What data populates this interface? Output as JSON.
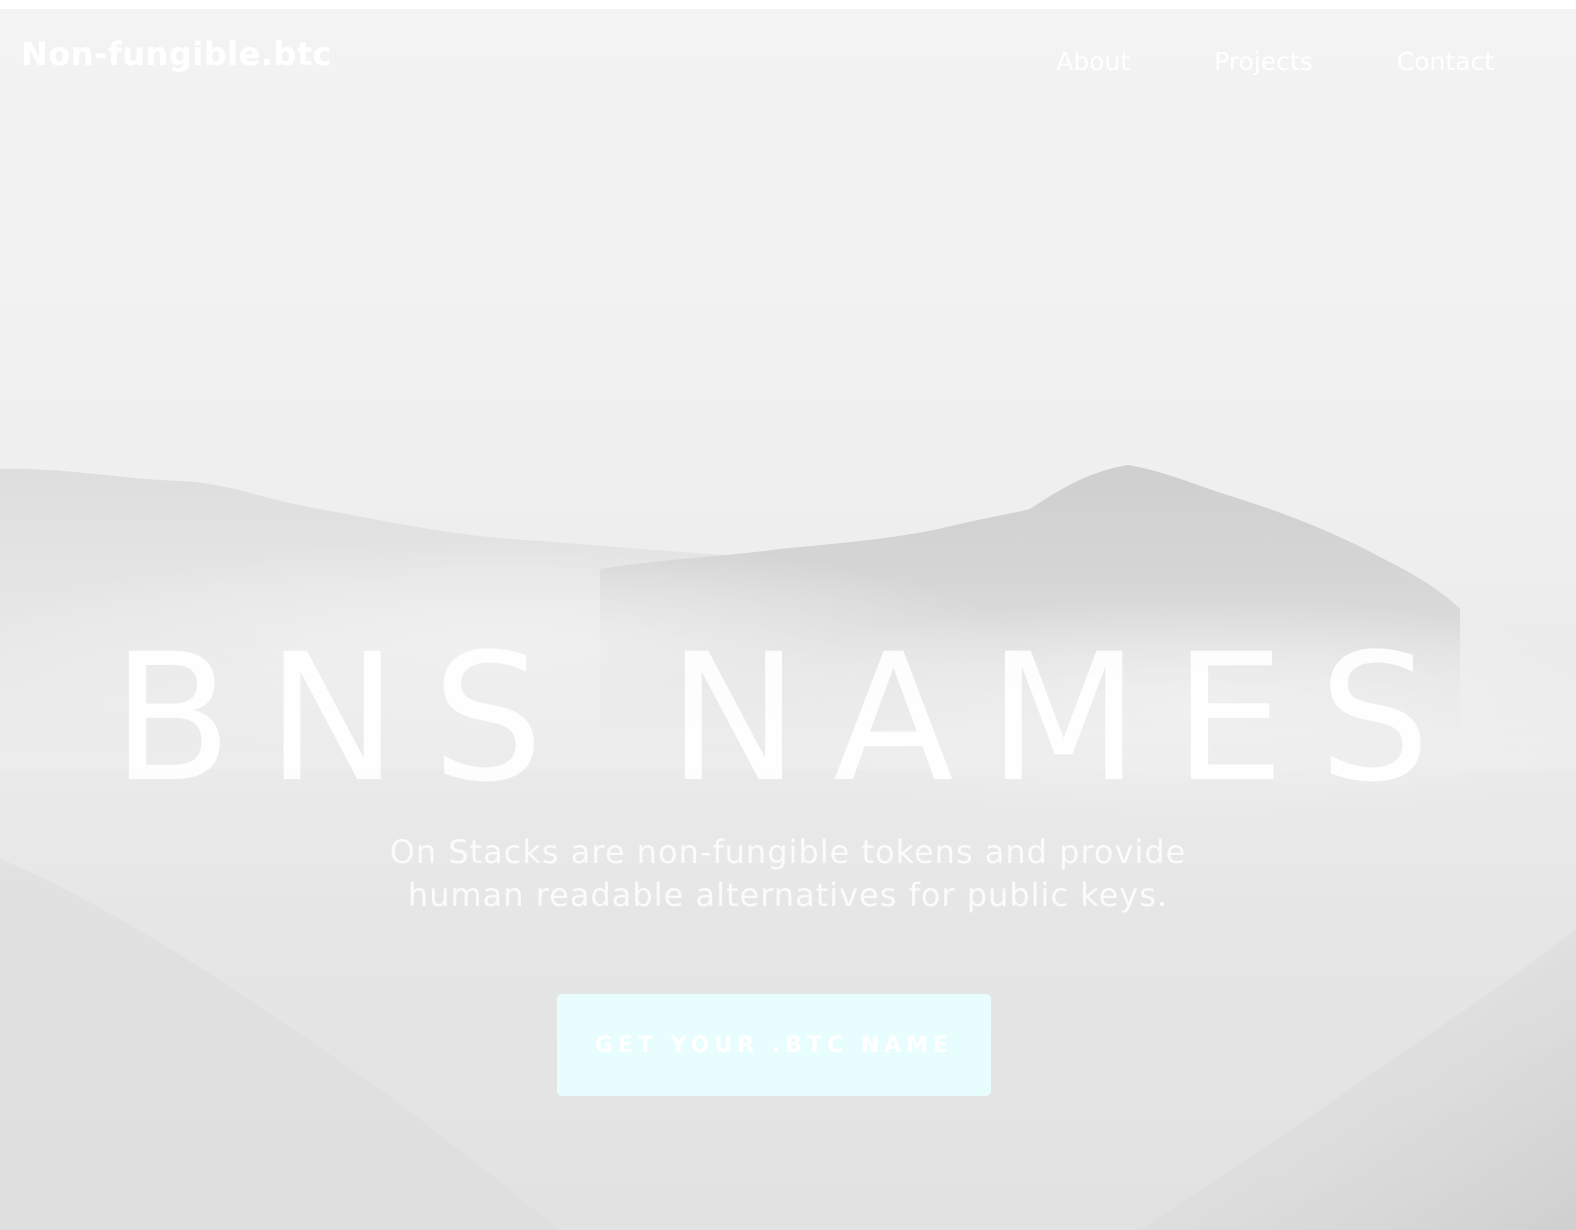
{
  "nav": {
    "logo": "Non-fungible.btc",
    "links": [
      "About",
      "Projects",
      "Contact"
    ]
  },
  "hero": {
    "title": "BNS NAMES",
    "subtitle_line1": "On Stacks are non-fungible tokens and provide",
    "subtitle_line2": "human readable alternatives for public keys.",
    "cta_label": "GET YOUR .BTC NAME",
    "background": "misty-mountains"
  },
  "colors": {
    "sky": "#f2f2f2",
    "mountain": "#d3d3d3",
    "text": "#ffffff",
    "cta_background": "#e8fdfd"
  }
}
